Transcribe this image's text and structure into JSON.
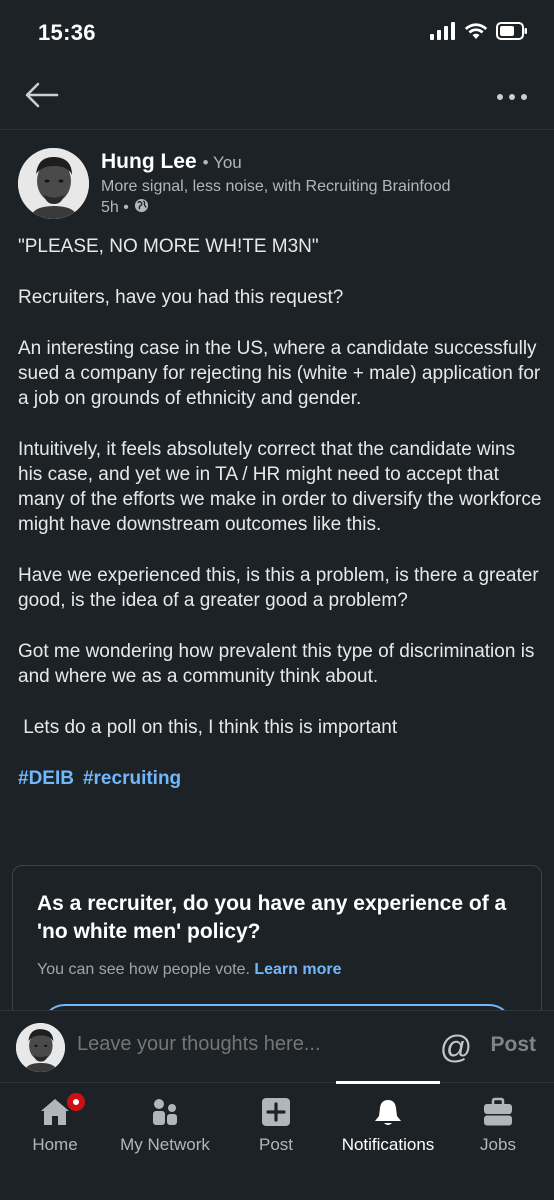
{
  "status_bar": {
    "time": "15:36"
  },
  "post": {
    "author": {
      "name": "Hung Lee",
      "relation": "• You",
      "headline": "More signal, less noise, with Recruiting Brainfood",
      "time": "5h •"
    },
    "body": [
      "\"PLEASE, NO MORE WH!TE M3N\"",
      "Recruiters, have you had this request?",
      "An interesting case in the US, where a candidate successfully sued a company for rejecting his (white + male) application for a job on grounds of ethnicity and gender.",
      "Intuitively, it feels absolutely correct that the candidate wins his case, and yet we in TA / HR might need to accept that many of the efforts we make in order to diversify the workforce might have downstream outcomes like this.",
      "Have we experienced this, is this a problem, is there a greater good, is the idea of a greater good a problem?",
      "Got me wondering how prevalent this type of discrimination is and where we as a community think about.",
      " Lets do a poll on this, I think this is important"
    ],
    "hashtags": [
      "#DEIB",
      "#recruiting"
    ]
  },
  "poll": {
    "question": "As a recruiter, do you have any experience of a 'no white men' policy?",
    "note": "You can see how people vote.",
    "learn_more": "Learn more"
  },
  "comment_bar": {
    "placeholder": "Leave your thoughts here...",
    "mention": "@",
    "post_label": "Post"
  },
  "bottom_nav": {
    "items": [
      {
        "label": "Home",
        "icon": "home-icon"
      },
      {
        "label": "My Network",
        "icon": "network-icon"
      },
      {
        "label": "Post",
        "icon": "plus-square-icon"
      },
      {
        "label": "Notifications",
        "icon": "bell-icon",
        "active": true
      },
      {
        "label": "Jobs",
        "icon": "briefcase-icon"
      }
    ]
  },
  "colors": {
    "background": "#1d2226",
    "accent": "#71b7fb",
    "badge": "#cc1016"
  }
}
